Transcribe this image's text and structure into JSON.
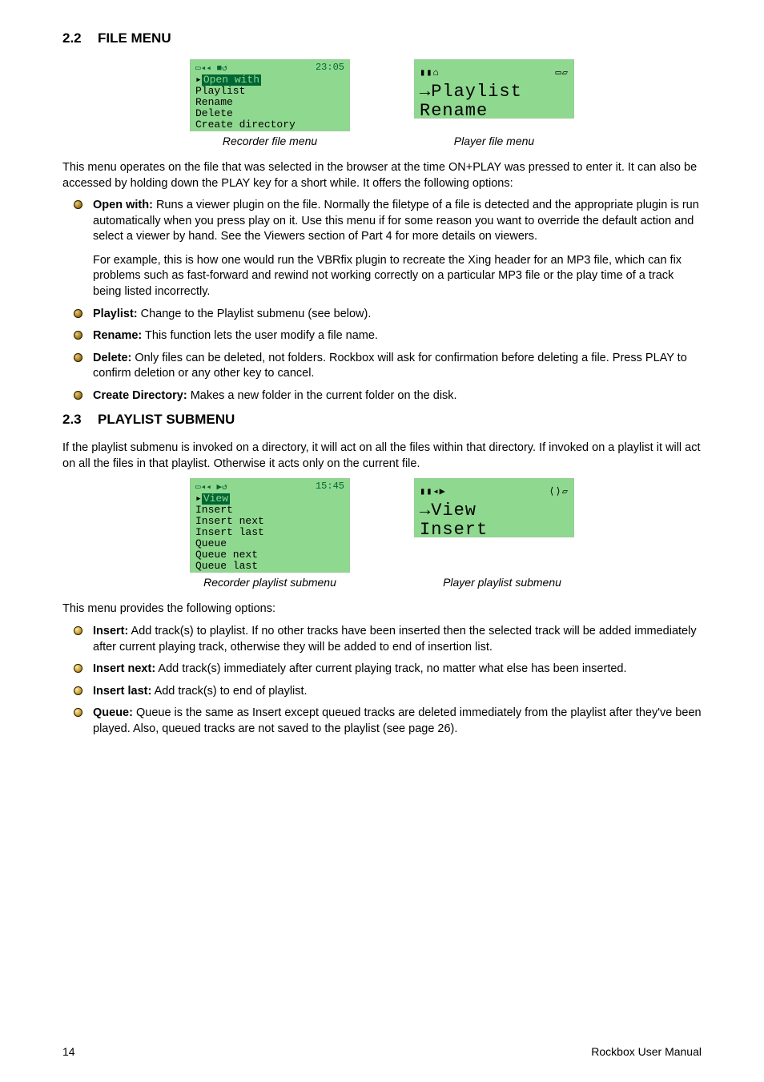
{
  "section22": {
    "num": "2.2",
    "title": "FILE MENU"
  },
  "fig1": {
    "recorder": {
      "clock": "23:05",
      "icons": "▭◂◂ ■↺",
      "lines": [
        "Open with",
        "Playlist",
        "Rename",
        "Delete",
        "Create directory"
      ],
      "sel_index": 0
    },
    "player": {
      "top_left": "▮▮⌂",
      "top_right": "▭▱",
      "line1": "→Playlist",
      "line2": " Rename"
    },
    "caption_recorder": "Recorder file menu",
    "caption_player": "Player file menu"
  },
  "para22_intro": "This menu operates on the file that was selected in the browser at the time ON+PLAY was pressed to enter it.  It can also be accessed by holding down the PLAY key for a short while.  It offers the following options:",
  "bullets22": [
    {
      "label": "Open with:",
      "text": " Runs a viewer plugin on the file.  Normally the filetype of a file is detected and the appropriate plugin is run automatically when you press play on it.  Use this menu if for some reason you want to override the default action and select a viewer by hand.  See the Viewers section of Part 4 for more details on viewers.",
      "sub": "For example, this is how one would run the VBRfix plugin to recreate the Xing header for an MP3 file, which can fix problems such as fast-forward and rewind not working correctly on a particular MP3 file or the play time of a track being listed incorrectly."
    },
    {
      "label": "Playlist:",
      "text": " Change to the Playlist submenu (see below)."
    },
    {
      "label": "Rename:",
      "text": " This function lets the user modify a file name."
    },
    {
      "label": "Delete:",
      "text": " Only files can be deleted, not folders. Rockbox will ask for confirmation before deleting a file. Press PLAY to confirm deletion or any other key to cancel."
    },
    {
      "label": "Create Directory:",
      "text": " Makes a new folder in the current folder on the disk."
    }
  ],
  "section23": {
    "num": "2.3",
    "title": "PLAYLIST SUBMENU"
  },
  "para23_intro": "If the playlist submenu is invoked on a directory, it will act on all the files within that directory.  If invoked on a playlist it will act on all the files in that playlist.  Otherwise it acts only on the current file.",
  "fig2": {
    "recorder": {
      "clock": "15:45",
      "icons": "▭◂◂ ▶↺",
      "lines": [
        "View",
        "Insert",
        "Insert next",
        "Insert last",
        "Queue",
        "Queue next",
        "Queue last"
      ],
      "sel_index": 0
    },
    "player": {
      "top_left": "▮▮◂▶",
      "top_right": "⟨⟩▱",
      "line1": "→View",
      "line2": " Insert"
    },
    "caption_recorder": "Recorder playlist submenu",
    "caption_player": "Player playlist submenu"
  },
  "para23_after": "This menu provides the following options:",
  "bullets23": [
    {
      "label": "Insert:",
      "text": " Add track(s) to playlist. If no other tracks have been inserted then the selected track will be added immediately after current playing track, otherwise they will be added to end of insertion list."
    },
    {
      "label": "Insert next:",
      "text": " Add track(s) immediately after current playing track, no matter what else has been inserted."
    },
    {
      "label": "Insert last:",
      "text": " Add track(s) to end of playlist."
    },
    {
      "label": "Queue:",
      "text": " Queue is the same as Insert except queued tracks are deleted immediately from the playlist after they've been played. Also, queued tracks are not saved to the playlist (see page 26)."
    }
  ],
  "footer": {
    "page": "14",
    "title": "Rockbox User Manual"
  }
}
